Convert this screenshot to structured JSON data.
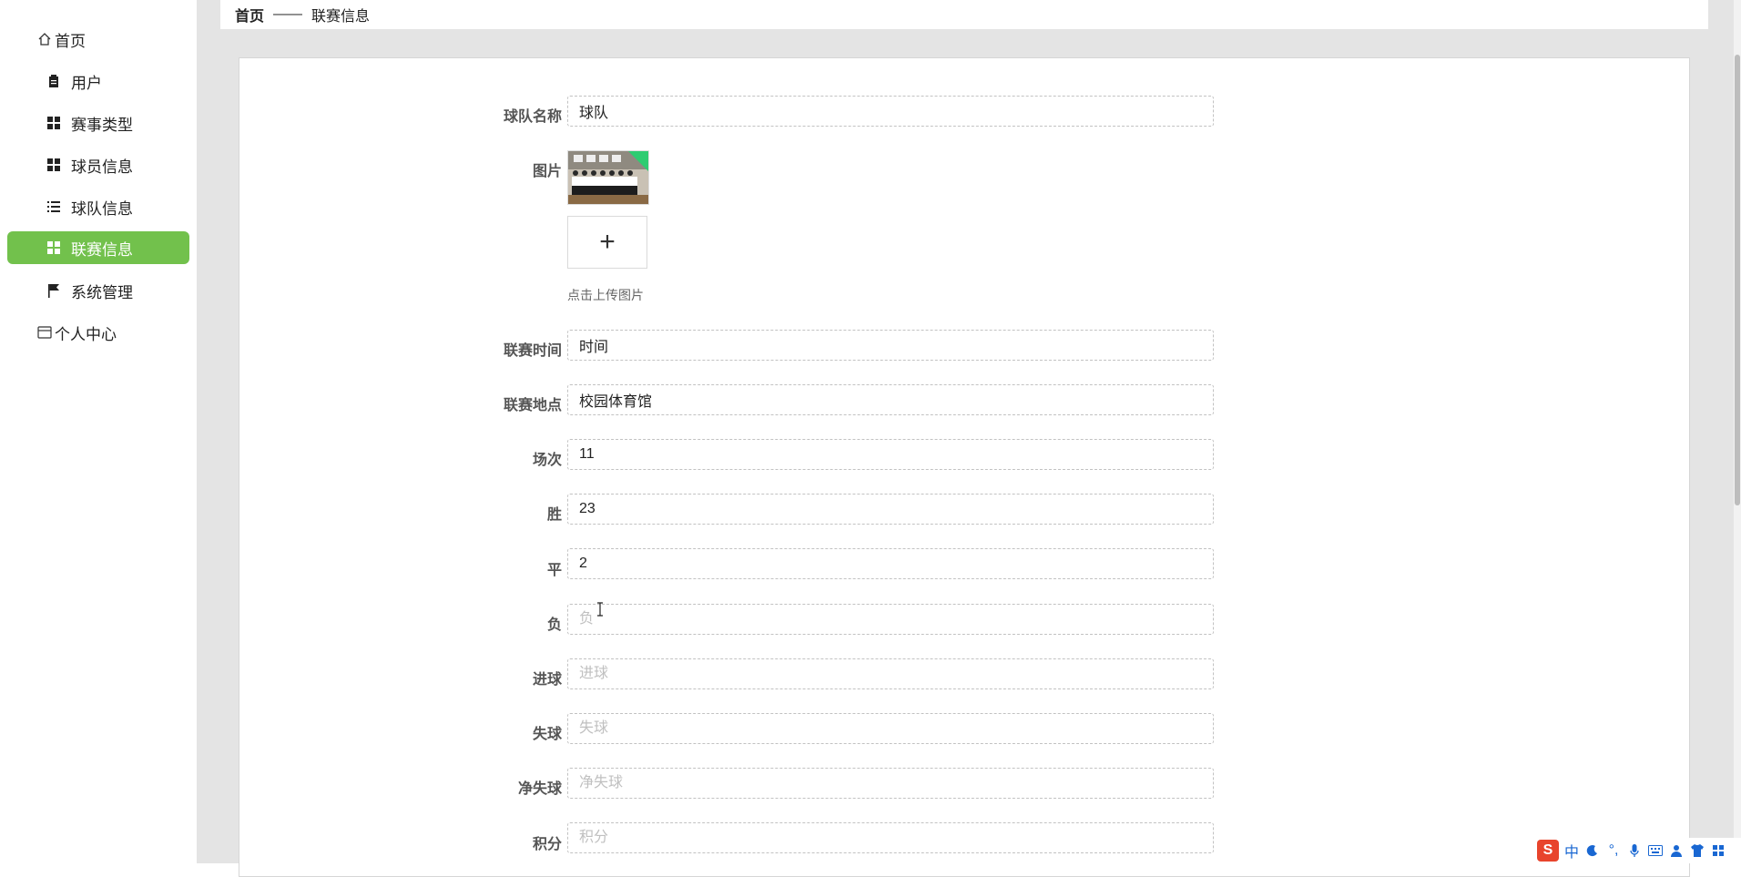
{
  "sidebar": {
    "items": [
      {
        "label": "首页",
        "icon": "home-icon"
      },
      {
        "label": "用户",
        "icon": "clipboard-icon"
      },
      {
        "label": "赛事类型",
        "icon": "grid-icon"
      },
      {
        "label": "球员信息",
        "icon": "grid-icon"
      },
      {
        "label": "球队信息",
        "icon": "list-icon"
      },
      {
        "label": "联赛信息",
        "icon": "grid-icon",
        "active": true
      },
      {
        "label": "系统管理",
        "icon": "flag-icon"
      },
      {
        "label": "个人中心",
        "icon": "card-icon"
      }
    ]
  },
  "breadcrumb": {
    "home": "首页",
    "separator": "——",
    "current": "联赛信息"
  },
  "form": {
    "team_name": {
      "label": "球队名称",
      "value": "球队",
      "placeholder": ""
    },
    "image": {
      "label": "图片",
      "upload_hint": "点击上传图片",
      "upload_symbol": "+"
    },
    "league_time": {
      "label": "联赛时间",
      "value": "时间",
      "placeholder": ""
    },
    "league_place": {
      "label": "联赛地点",
      "value": "校园体育馆",
      "placeholder": ""
    },
    "matches": {
      "label": "场次",
      "value": "11",
      "placeholder": ""
    },
    "wins": {
      "label": "胜",
      "value": "23",
      "placeholder": ""
    },
    "draws": {
      "label": "平",
      "value": "2",
      "placeholder": ""
    },
    "losses": {
      "label": "负",
      "value": "",
      "placeholder": "负"
    },
    "goals_for": {
      "label": "进球",
      "value": "",
      "placeholder": "进球"
    },
    "goals_against": {
      "label": "失球",
      "value": "",
      "placeholder": "失球"
    },
    "goal_diff": {
      "label": "净失球",
      "value": "",
      "placeholder": "净失球"
    },
    "points": {
      "label": "积分",
      "value": "",
      "placeholder": "积分"
    }
  },
  "ime": {
    "logo": "S",
    "mode": "中",
    "punct": "°,"
  },
  "colors": {
    "accent": "#72c14c",
    "main_bg": "#e4e4e4"
  }
}
